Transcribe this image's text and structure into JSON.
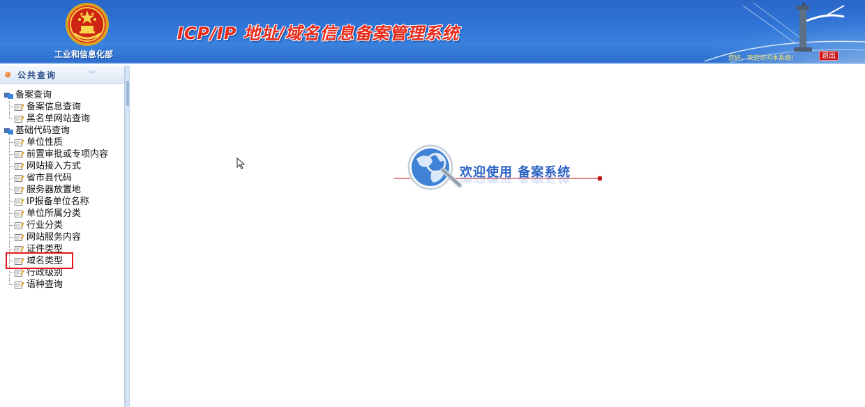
{
  "header": {
    "ministry_name": "工业和信息化部",
    "system_title": "ICP/IP 地址/域名信息备案管理系统",
    "greeting": "您好，欢迎访问本系统!",
    "logout_label": "退出"
  },
  "sidebar": {
    "panel_title": "公共查询",
    "groups": [
      {
        "label": "备案查询",
        "items": [
          {
            "label": "备案信息查询"
          },
          {
            "label": "黑名单网站查询"
          }
        ]
      },
      {
        "label": "基础代码查询",
        "items": [
          {
            "label": "单位性质"
          },
          {
            "label": "前置审批或专项内容"
          },
          {
            "label": "网站接入方式"
          },
          {
            "label": "省市县代码"
          },
          {
            "label": "服务器放置地"
          },
          {
            "label": "IP报备单位名称"
          },
          {
            "label": "单位所属分类"
          },
          {
            "label": "行业分类"
          },
          {
            "label": "网站服务内容"
          },
          {
            "label": "证件类型"
          },
          {
            "label": "域名类型"
          },
          {
            "label": "行政级别"
          },
          {
            "label": "语种查询"
          }
        ]
      }
    ],
    "highlighted_item": "域名类型"
  },
  "main": {
    "welcome_text": "欢迎使用  备案系统"
  },
  "colors": {
    "header_blue": "#2f74d6",
    "title_red": "#e72a1a",
    "highlight_red": "#e3171b",
    "welcome_blue": "#2c63c4"
  },
  "icons": {
    "emblem": "national-emblem-icon",
    "group": "folder-group-icon",
    "leaf": "document-pencil-icon",
    "welcome": "globe-magnifier-icon"
  }
}
